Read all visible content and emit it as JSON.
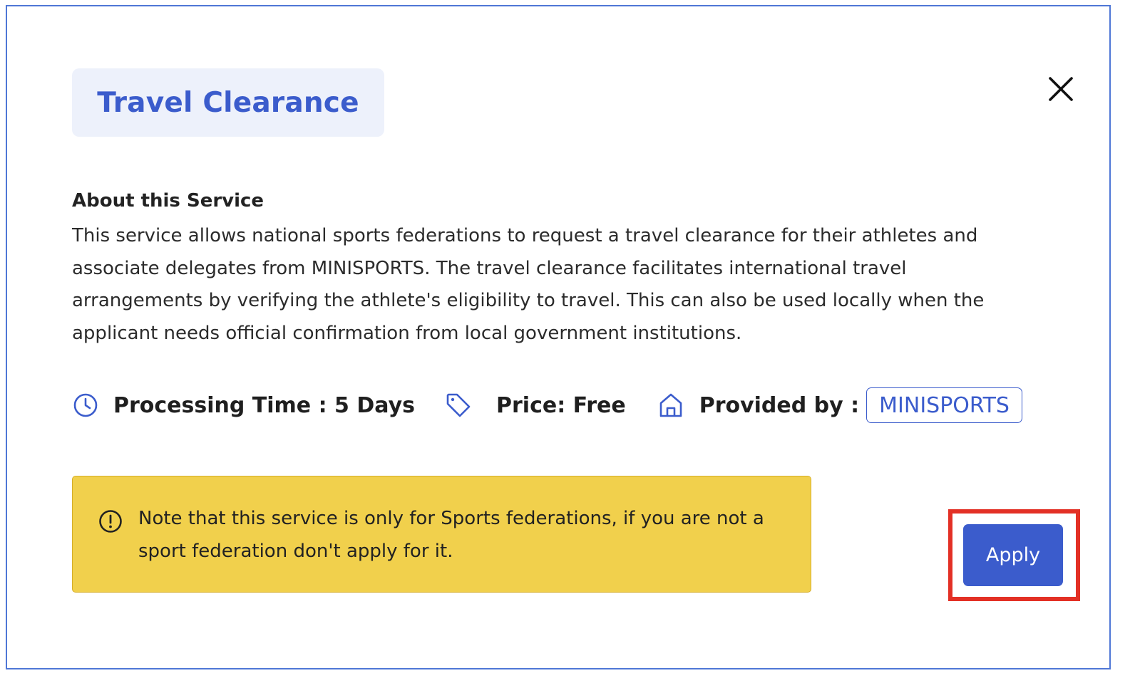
{
  "dialog": {
    "title": "Travel Clearance",
    "close_icon": "close-icon",
    "about": {
      "heading": "About this Service",
      "body": "This service allows national sports federations to request a travel clearance for their athletes and associate delegates from MINISPORTS. The travel clearance facilitates international travel arrangements by verifying the athlete's eligibility to travel. This can also be used locally when the applicant needs official confirmation from local government institutions."
    },
    "meta": {
      "processing_icon": "clock-icon",
      "processing_time": "Processing Time : 5 Days",
      "price_icon": "tag-icon",
      "price": "Price: Free",
      "provider_icon": "home-icon",
      "provided_by_label": "Provided by :",
      "provider": "MINISPORTS"
    },
    "note": {
      "icon": "info-circle-icon",
      "text": "Note that this service is only for Sports federations, if you are not a sport federation don't apply for it."
    },
    "apply_label": "Apply"
  },
  "colors": {
    "accent": "#3b5ccc",
    "frame_border": "#4f77d6",
    "title_chip_bg": "#edf1fb",
    "note_bg": "#f1d04c",
    "highlight": "#e33025"
  }
}
